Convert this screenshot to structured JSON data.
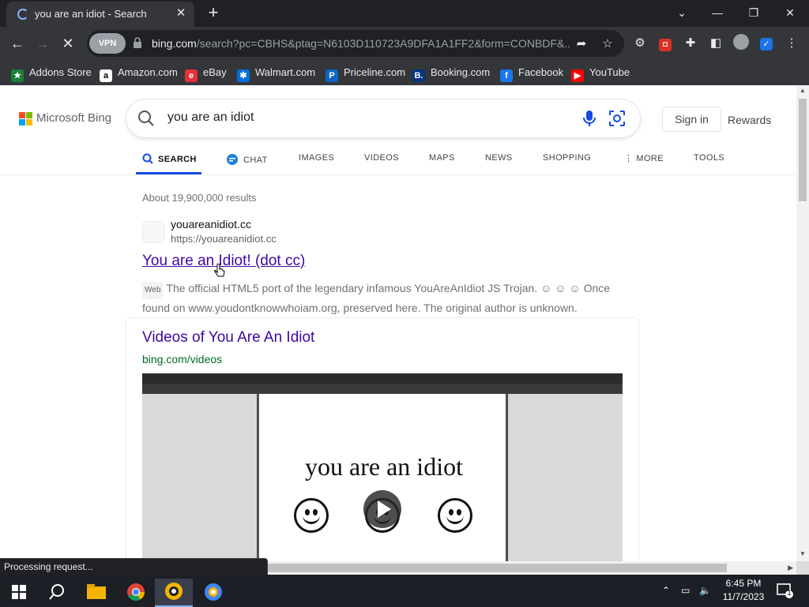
{
  "browser": {
    "tab_title": "you are an idiot - Search",
    "url_host": "bing.com",
    "url_path": "/search?pc=CBHS&ptag=N6103D110723A9DFA1A1FF2&form=CONBDF&...",
    "vpn_label": "VPN",
    "bookmarks": [
      {
        "label": "Addons Store",
        "icon": "addons-store-icon",
        "color": "#1a7f37",
        "glyph": "★"
      },
      {
        "label": "Amazon.com",
        "icon": "amazon-icon",
        "color": "#ffffff",
        "glyph": "a"
      },
      {
        "label": "eBay",
        "icon": "ebay-icon",
        "color": "#e53238",
        "glyph": "e"
      },
      {
        "label": "Walmart.com",
        "icon": "walmart-icon",
        "color": "#0071dc",
        "glyph": "✱"
      },
      {
        "label": "Priceline.com",
        "icon": "priceline-icon",
        "color": "#0a66c2",
        "glyph": "P"
      },
      {
        "label": "Booking.com",
        "icon": "booking-icon",
        "color": "#003580",
        "glyph": "B."
      },
      {
        "label": "Facebook",
        "icon": "facebook-icon",
        "color": "#1877f2",
        "glyph": "f"
      },
      {
        "label": "YouTube",
        "icon": "youtube-icon",
        "color": "#ff0000",
        "glyph": "▶"
      }
    ],
    "status_text": "Processing request..."
  },
  "bing": {
    "logo_text": "Microsoft Bing",
    "query": "you are an idiot",
    "sign_in": "Sign in",
    "rewards": "Rewards",
    "scopes": [
      "SEARCH",
      "CHAT",
      "IMAGES",
      "VIDEOS",
      "MAPS",
      "NEWS",
      "SHOPPING",
      "MORE",
      "TOOLS"
    ],
    "result_count": "About 19,900,000 results",
    "result1": {
      "site_name": "youareanidiot.cc",
      "site_url": "https://youareanidiot.cc",
      "title": "You are an Idiot! (dot cc)",
      "web_label": "Web",
      "snippet": "The official HTML5 port of the legendary infamous YouAreAnIdiot JS Trojan. ☺ ☺ ☺ Once found on www.youdontknowwhoiam.org, preserved here. The original author is unknown."
    },
    "videos_card": {
      "title": "Videos of You Are An Idiot",
      "url": "bing.com/videos",
      "thumbnail_text": "you are an idiot"
    }
  },
  "taskbar": {
    "time": "6:45 PM",
    "date": "11/7/2023",
    "notifications": "1"
  },
  "colors": {
    "link_visited": "#4007a2",
    "url_green": "#006d21",
    "bing_accent": "#174ae4"
  }
}
